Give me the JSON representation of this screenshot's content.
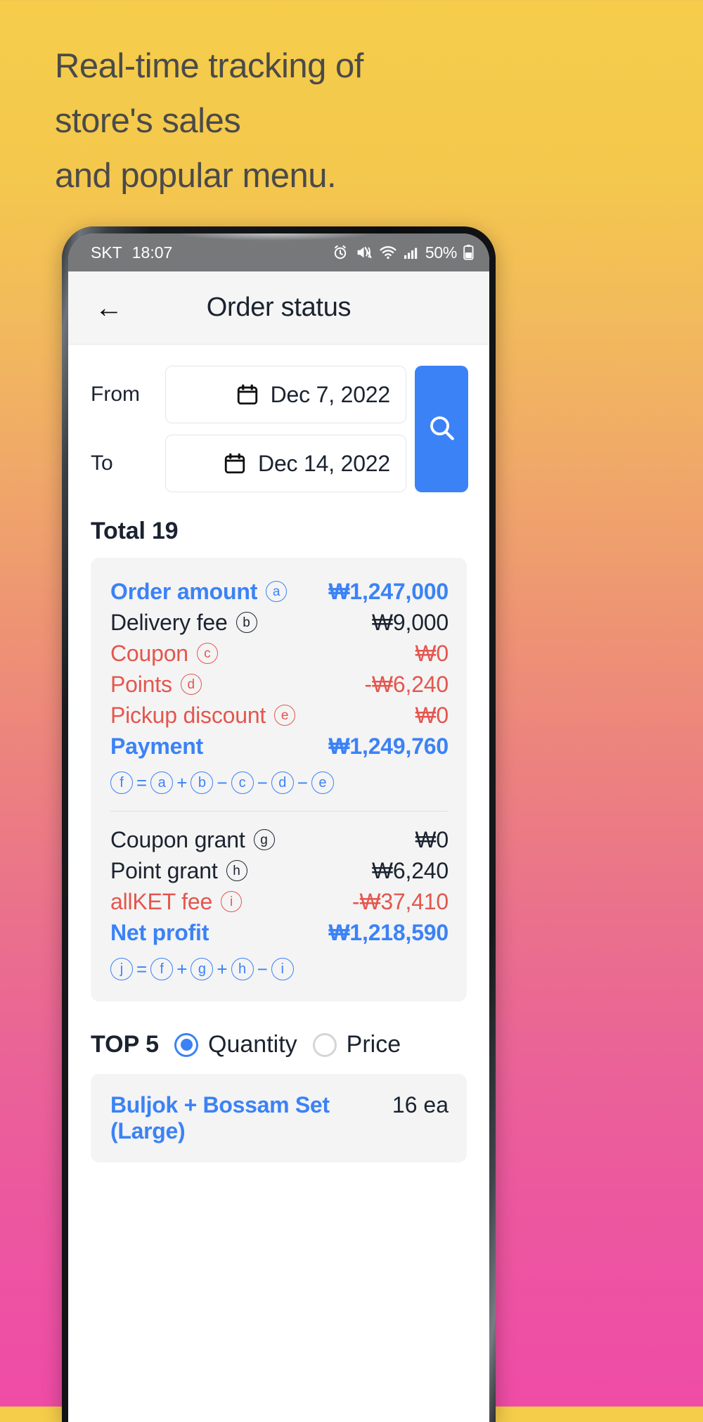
{
  "promo": {
    "line1": "Real-time tracking of",
    "line2": "store's sales",
    "line3": "and popular menu."
  },
  "statusbar": {
    "carrier": "SKT",
    "time": "18:07",
    "battery": "50%",
    "icons": [
      "alarm-icon",
      "mute-icon",
      "wifi-icon",
      "signal-icon",
      "battery-icon"
    ]
  },
  "appbar": {
    "back": "←",
    "title": "Order status"
  },
  "filter": {
    "from_label": "From",
    "from_value": "Dec 7, 2022",
    "to_label": "To",
    "to_value": "Dec 14, 2022",
    "search_icon": "search-icon"
  },
  "summary": {
    "total_text": "Total 19",
    "rows_primary": [
      {
        "label": "Order amount",
        "tag": "a",
        "value": "₩1,247,000",
        "color": "blue",
        "bold": true
      },
      {
        "label": "Delivery fee",
        "tag": "b",
        "value": "₩9,000",
        "color": "dark",
        "bold": false
      },
      {
        "label": "Coupon",
        "tag": "c",
        "value": "₩0",
        "color": "red",
        "bold": false
      },
      {
        "label": "Points",
        "tag": "d",
        "value": "-₩6,240",
        "color": "red",
        "bold": false
      },
      {
        "label": "Pickup discount",
        "tag": "e",
        "value": "₩0",
        "color": "red",
        "bold": false
      },
      {
        "label": "Payment",
        "tag": "",
        "value": "₩1,249,760",
        "color": "blue",
        "bold": true
      }
    ],
    "formula_primary": [
      "f",
      "=",
      "a",
      "+",
      "b",
      "−",
      "c",
      "−",
      "d",
      "−",
      "e"
    ],
    "rows_secondary": [
      {
        "label": "Coupon grant",
        "tag": "g",
        "value": "₩0",
        "color": "dark",
        "bold": false
      },
      {
        "label": "Point grant",
        "tag": "h",
        "value": "₩6,240",
        "color": "dark",
        "bold": false
      },
      {
        "label": "allKET fee",
        "tag": "i",
        "value": "-₩37,410",
        "color": "red",
        "bold": false
      },
      {
        "label": "Net profit",
        "tag": "",
        "value": "₩1,218,590",
        "color": "blue",
        "bold": true
      }
    ],
    "formula_secondary": [
      "j",
      "=",
      "f",
      "+",
      "g",
      "+",
      "h",
      "−",
      "i"
    ]
  },
  "top5": {
    "label": "TOP 5",
    "options": [
      {
        "text": "Quantity",
        "selected": true
      },
      {
        "text": "Price",
        "selected": false
      }
    ],
    "items": [
      {
        "name": "Buljok + Bossam Set (Large)",
        "qty": "16 ea"
      }
    ]
  },
  "colors": {
    "accent_blue": "#3b82f6",
    "danger_red": "#e4564e",
    "text_dark": "#1b2330",
    "card_bg": "#f4f4f4"
  }
}
